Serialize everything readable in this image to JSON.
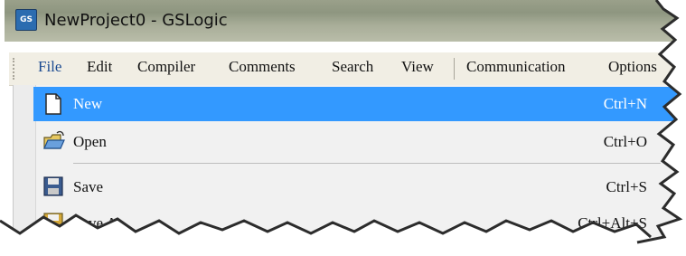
{
  "window": {
    "title": "NewProject0 - GSLogic",
    "app_icon_text": "GS"
  },
  "menubar": {
    "items": [
      {
        "label": "File"
      },
      {
        "label": "Edit"
      },
      {
        "label": "Compiler"
      },
      {
        "label": "Comments"
      },
      {
        "label": "Search"
      },
      {
        "label": "View"
      },
      {
        "label": "Communication"
      },
      {
        "label": "Options"
      }
    ]
  },
  "file_menu": {
    "items": [
      {
        "label": "New",
        "shortcut": "Ctrl+N",
        "icon": "new-document-icon",
        "highlighted": true
      },
      {
        "label": "Open",
        "shortcut": "Ctrl+O",
        "icon": "open-folder-icon"
      },
      {
        "label": "Save",
        "shortcut": "Ctrl+S",
        "icon": "save-disk-icon"
      },
      {
        "label": "Save As",
        "shortcut": "Ctrl+Alt+S",
        "icon": "save-as-icon"
      }
    ]
  },
  "colors": {
    "highlight": "#3399ff",
    "menubar_bg": "#f1eee4",
    "titlebar_bg": "#9aa08a"
  }
}
